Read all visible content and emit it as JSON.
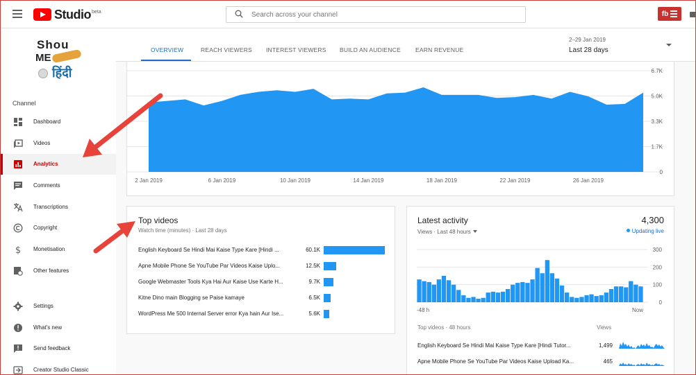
{
  "header": {
    "app_name": "Studio",
    "app_badge": "beta",
    "search_placeholder": "Search across your channel",
    "account_badge": "fb"
  },
  "channel": {
    "avatar_line1": "Shou",
    "avatar_line2": "ME",
    "avatar_line3": "हिंदी"
  },
  "sidebar": {
    "heading": "Channel",
    "items": [
      {
        "label": "Dashboard",
        "icon": "dashboard-icon"
      },
      {
        "label": "Videos",
        "icon": "video-icon"
      },
      {
        "label": "Analytics",
        "icon": "analytics-icon",
        "active": true
      },
      {
        "label": "Comments",
        "icon": "comment-icon"
      },
      {
        "label": "Transcriptions",
        "icon": "translate-icon"
      },
      {
        "label": "Copyright",
        "icon": "copyright-icon"
      },
      {
        "label": "Monetisation",
        "icon": "dollar-icon"
      },
      {
        "label": "Other features",
        "icon": "other-features-icon"
      },
      {
        "label": "Settings",
        "icon": "gear-icon"
      },
      {
        "label": "What's new",
        "icon": "alert-icon"
      },
      {
        "label": "Send feedback",
        "icon": "feedback-icon"
      },
      {
        "label": "Creator Studio Classic",
        "icon": "classic-icon"
      }
    ]
  },
  "tabs": {
    "items": [
      "OVERVIEW",
      "REACH VIEWERS",
      "INTEREST VIEWERS",
      "BUILD AN AUDIENCE",
      "EARN REVENUE"
    ],
    "active": "OVERVIEW"
  },
  "date_picker": {
    "range": "2–29 Jan 2019",
    "label": "Last 28 days"
  },
  "colors": {
    "accent": "#1e6cc4",
    "chart_fill": "#2196f3",
    "brand_red": "#ff0000",
    "arrow": "#e8433a"
  },
  "chart_data": [
    {
      "type": "area",
      "x_ticks": [
        "2 Jan 2019",
        "6 Jan 2019",
        "10 Jan 2019",
        "14 Jan 2019",
        "18 Jan 2019",
        "22 Jan 2019",
        "26 Jan 2019"
      ],
      "y_ticks": [
        "6.7K",
        "5.0K",
        "3.3K",
        "1.7K",
        "0"
      ],
      "ylim": [
        0,
        6700
      ],
      "x": [
        "2 Jan 2019",
        "3 Jan 2019",
        "4 Jan 2019",
        "5 Jan 2019",
        "6 Jan 2019",
        "7 Jan 2019",
        "8 Jan 2019",
        "9 Jan 2019",
        "10 Jan 2019",
        "11 Jan 2019",
        "12 Jan 2019",
        "13 Jan 2019",
        "14 Jan 2019",
        "15 Jan 2019",
        "16 Jan 2019",
        "17 Jan 2019",
        "18 Jan 2019",
        "19 Jan 2019",
        "20 Jan 2019",
        "21 Jan 2019",
        "22 Jan 2019",
        "23 Jan 2019",
        "24 Jan 2019",
        "25 Jan 2019",
        "26 Jan 2019",
        "27 Jan 2019",
        "28 Jan 2019",
        "29 Jan 2019"
      ],
      "values": [
        4600,
        4700,
        4800,
        4400,
        4700,
        5100,
        5300,
        5400,
        5300,
        5500,
        4800,
        4850,
        4800,
        5200,
        5250,
        5600,
        5100,
        5100,
        5100,
        4900,
        4950,
        5100,
        4850,
        5300,
        5000,
        4450,
        4500,
        5250
      ]
    },
    {
      "type": "bar",
      "title": "Latest activity",
      "total": "4,300",
      "subtitle": "Views · Last 48 hours",
      "status": "Updating live",
      "x_ticks": [
        "-48 h",
        "Now"
      ],
      "y_ticks": [
        "300",
        "200",
        "100",
        "0"
      ],
      "ylim": [
        0,
        300
      ],
      "values": [
        130,
        120,
        115,
        100,
        130,
        150,
        125,
        100,
        70,
        40,
        25,
        30,
        20,
        25,
        55,
        60,
        55,
        60,
        75,
        100,
        110,
        115,
        110,
        130,
        195,
        165,
        240,
        165,
        135,
        95,
        55,
        30,
        25,
        30,
        40,
        45,
        35,
        40,
        55,
        75,
        90,
        90,
        85,
        120,
        100,
        90
      ]
    }
  ],
  "top_videos": {
    "title": "Top videos",
    "subtitle": "Watch time (minutes) · Last 28 days",
    "items": [
      {
        "title": "English Keyboard Se Hindi Mai Kaise Type Kare [Hindi ...",
        "value_label": "60.1K",
        "value": 60100
      },
      {
        "title": "Apne Mobile Phone Se YouTube Par Videos Kaise Uplo...",
        "value_label": "12.5K",
        "value": 12500
      },
      {
        "title": "Google Webmaster Tools Kya Hai Aur Kaise Use Karte H...",
        "value_label": "9.7K",
        "value": 9700
      },
      {
        "title": "Kitne Dino main Blogging se Paise kamaye",
        "value_label": "6.5K",
        "value": 6500
      },
      {
        "title": "WordPress Me 500 Internal Server error Kya hain Aur Ise...",
        "value_label": "5.6K",
        "value": 5600
      }
    ]
  },
  "latest_activity": {
    "top_videos_label": "Top videos · 48 hours",
    "views_label": "Views",
    "rows": [
      {
        "title": "English Keyboard Se Hindi Mai Kaise Type Kare [Hindi Tutor...",
        "views": "1,499"
      },
      {
        "title": "Apne Mobile Phone Se YouTube Par Videos Kaise Upload Ka...",
        "views": "465"
      }
    ]
  }
}
